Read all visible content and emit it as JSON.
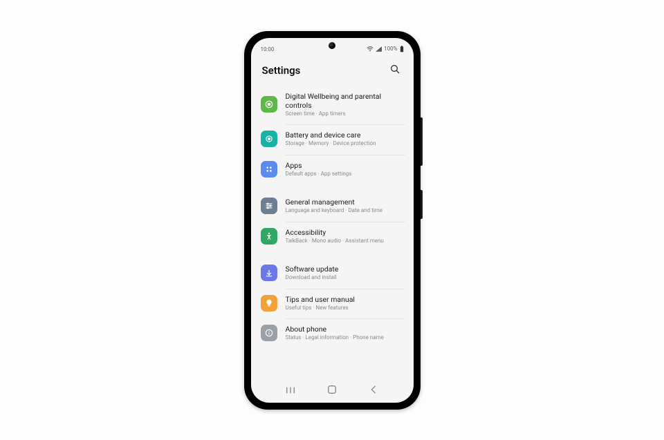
{
  "status": {
    "time": "10:00",
    "battery": "100%"
  },
  "header": {
    "title": "Settings"
  },
  "colors": {
    "wellbeing": "#5fb749",
    "battery": "#19b3a6",
    "apps": "#5a8cf0",
    "general": "#6f7d92",
    "accessibility": "#2fa866",
    "software": "#6c78e8",
    "tips": "#f2a23a",
    "about": "#9aa0a6"
  },
  "items": [
    {
      "id": "wellbeing",
      "title": "Digital Wellbeing and parental controls",
      "sub": "Screen time  ·  App timers"
    },
    {
      "id": "battery",
      "title": "Battery and device care",
      "sub": "Storage  ·  Memory  ·  Device protection"
    },
    {
      "id": "apps",
      "title": "Apps",
      "sub": "Default apps  ·  App settings"
    },
    {
      "id": "general",
      "title": "General management",
      "sub": "Language and keyboard  ·  Date and time"
    },
    {
      "id": "accessibility",
      "title": "Accessibility",
      "sub": "TalkBack  ·  Mono audio  ·  Assistant menu"
    },
    {
      "id": "software",
      "title": "Software update",
      "sub": "Download and install"
    },
    {
      "id": "tips",
      "title": "Tips and user manual",
      "sub": "Useful tips  ·  New features"
    },
    {
      "id": "about",
      "title": "About phone",
      "sub": "Status  ·  Legal information  ·  Phone name"
    }
  ]
}
